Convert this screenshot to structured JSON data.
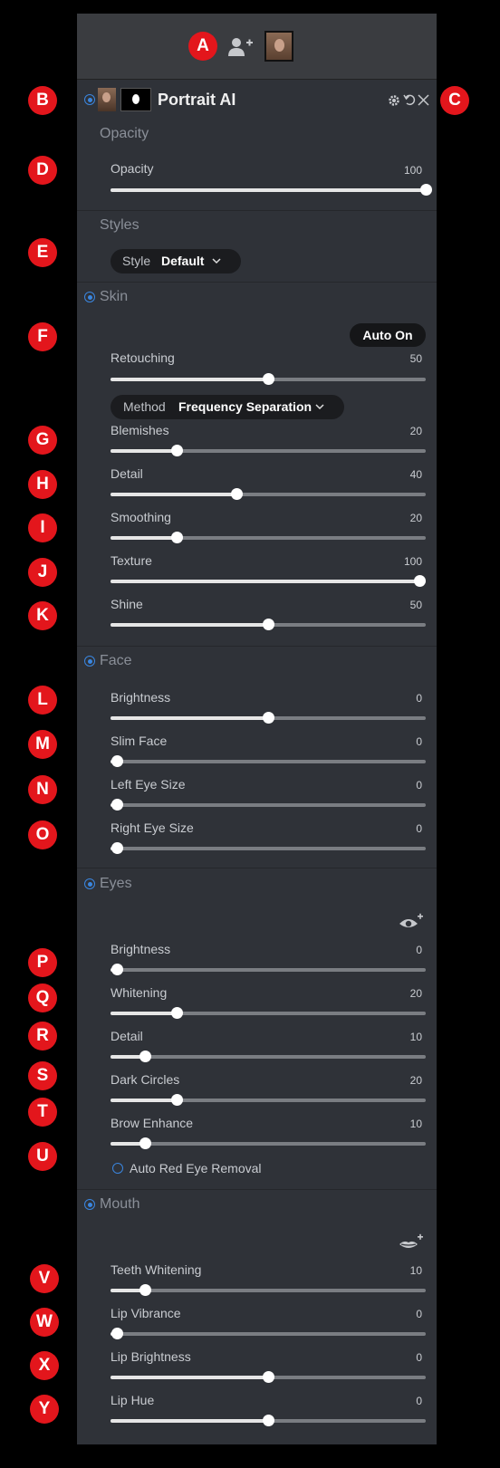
{
  "header": {
    "title": "Portrait AI",
    "add_person_icon": "add-person-icon",
    "thumbnail_icon": "portrait-thumbnail-icon",
    "mask_icon": "mask-icon",
    "gear_icon": "gear-icon",
    "undo_icon": "undo-icon",
    "close_icon": "close-icon"
  },
  "markers": [
    "A",
    "B",
    "C",
    "D",
    "E",
    "F",
    "G",
    "H",
    "I",
    "J",
    "K",
    "L",
    "M",
    "N",
    "O",
    "P",
    "Q",
    "R",
    "S",
    "T",
    "U",
    "V",
    "W",
    "X",
    "Y"
  ],
  "opacity": {
    "title": "Opacity",
    "slider": {
      "label": "Opacity",
      "value": "100",
      "fraction": 1.0
    }
  },
  "styles": {
    "title": "Styles",
    "style_label": "Style",
    "style_value": "Default"
  },
  "skin": {
    "title": "Skin",
    "auto_button": "Auto On",
    "retouching": {
      "label": "Retouching",
      "value": "50",
      "fraction": 0.5
    },
    "method_label": "Method",
    "method_value": "Frequency Separation",
    "sliders": [
      {
        "label": "Blemishes",
        "value": "20",
        "fraction": 0.21
      },
      {
        "label": "Detail",
        "value": "40",
        "fraction": 0.4
      },
      {
        "label": "Smoothing",
        "value": "20",
        "fraction": 0.21
      },
      {
        "label": "Texture",
        "value": "100",
        "fraction": 0.98
      },
      {
        "label": "Shine",
        "value": "50",
        "fraction": 0.5
      }
    ]
  },
  "face": {
    "title": "Face",
    "sliders": [
      {
        "label": "Brightness",
        "value": "0",
        "fraction": 0.5
      },
      {
        "label": "Slim Face",
        "value": "0",
        "fraction": 0.02
      },
      {
        "label": "Left Eye Size",
        "value": "0",
        "fraction": 0.02
      },
      {
        "label": "Right Eye Size",
        "value": "0",
        "fraction": 0.02
      }
    ]
  },
  "eyes": {
    "title": "Eyes",
    "add_eye_icon": "add-eye-icon",
    "sliders": [
      {
        "label": "Brightness",
        "value": "0",
        "fraction": 0.02
      },
      {
        "label": "Whitening",
        "value": "20",
        "fraction": 0.21
      },
      {
        "label": "Detail",
        "value": "10",
        "fraction": 0.11
      },
      {
        "label": "Dark Circles",
        "value": "20",
        "fraction": 0.21
      },
      {
        "label": "Brow Enhance",
        "value": "10",
        "fraction": 0.11
      }
    ],
    "red_eye_label": "Auto Red Eye Removal"
  },
  "mouth": {
    "title": "Mouth",
    "add_mouth_icon": "add-lips-icon",
    "sliders": [
      {
        "label": "Teeth Whitening",
        "value": "10",
        "fraction": 0.11
      },
      {
        "label": "Lip Vibrance",
        "value": "0",
        "fraction": 0.02
      },
      {
        "label": "Lip Brightness",
        "value": "0",
        "fraction": 0.5
      },
      {
        "label": "Lip Hue",
        "value": "0",
        "fraction": 0.5
      }
    ]
  },
  "colors": {
    "marker": "#e3161c",
    "accent": "#3a86e0",
    "panel": "#2f3238"
  }
}
